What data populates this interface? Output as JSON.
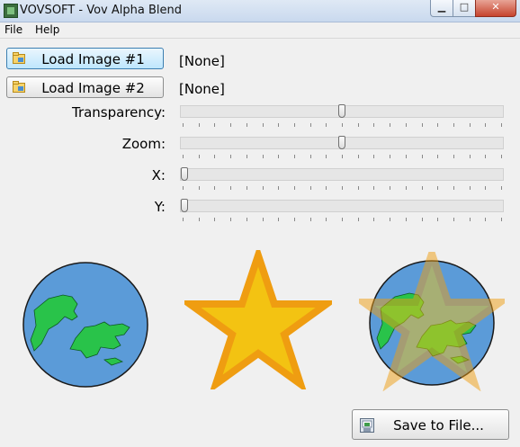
{
  "window": {
    "title": "VOVSOFT - Vov Alpha Blend",
    "min_icon": "minimize-icon",
    "max_icon": "maximize-icon",
    "close_icon": "close-icon"
  },
  "menu": {
    "file": "File",
    "help": "Help"
  },
  "buttons": {
    "load1": "Load Image #1",
    "load2": "Load Image #2",
    "save": "Save to File..."
  },
  "status": {
    "image1": "[None]",
    "image2": "[None]"
  },
  "sliders": {
    "transparency": {
      "label": "Transparency:",
      "value": 0.5
    },
    "zoom": {
      "label": "Zoom:",
      "value": 0.5
    },
    "x": {
      "label": "X:",
      "value": 0.0
    },
    "y": {
      "label": "Y:",
      "value": 0.0
    }
  },
  "colors": {
    "globe_water": "#5b9bd8",
    "globe_land": "#29c34a",
    "star_fill": "#f3c312",
    "star_stroke": "#ef9d11"
  }
}
